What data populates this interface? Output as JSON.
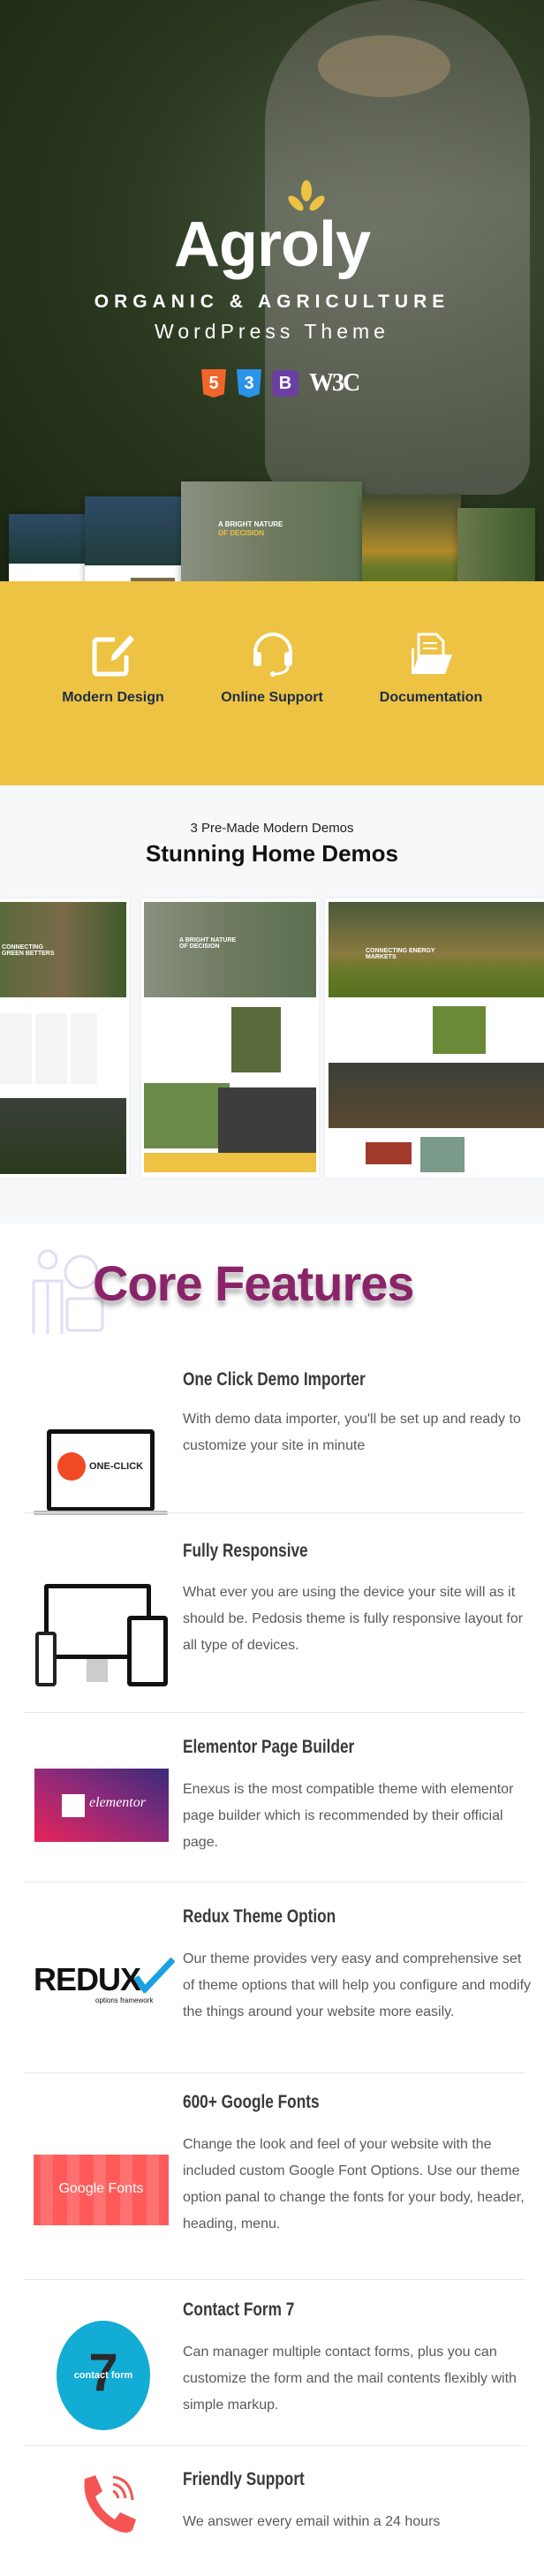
{
  "hero": {
    "logo": "Agroly",
    "tagline": "ORGANIC & AGRICULTURE",
    "subtitle": "WordPress Theme",
    "badges": [
      {
        "icon": "html5-icon",
        "label": "5",
        "color": "#f16529"
      },
      {
        "icon": "css3-icon",
        "label": "3",
        "color": "#2b94e8"
      },
      {
        "icon": "bootstrap-icon",
        "label": "B",
        "color": "#6b3fa0"
      },
      {
        "icon": "w3c-icon",
        "label": "W3C"
      }
    ],
    "mockup_heading": [
      "A BRIGHT NATURE",
      "OF DECISION"
    ]
  },
  "highlights": [
    {
      "icon": "edit-icon",
      "label": "Modern Design"
    },
    {
      "icon": "headset-icon",
      "label": "Online Support"
    },
    {
      "icon": "folder-document-icon",
      "label": "Documentation"
    }
  ],
  "demos": {
    "subtitle": "3 Pre-Made Modern Demos",
    "title": "Stunning Home Demos",
    "cards": [
      {
        "headline": "CONNECTING GREEN BETTERS"
      },
      {
        "headline": "A BRIGHT NATURE OF DECISION"
      },
      {
        "headline": "CONNECTING ENERGY MARKETS"
      }
    ]
  },
  "core": {
    "title": "Core Features",
    "features": [
      {
        "title": "One Click Demo Importer",
        "image": "one-click",
        "image_text": "ONE-CLICK",
        "desc": "With demo data importer, you'll be set up and ready to customize your site in minute"
      },
      {
        "title": "Fully Responsive",
        "image": "devices",
        "desc": "What ever you are using the device your site will as it should be. Pedosis theme is fully responsive layout for all type of devices."
      },
      {
        "title": "Elementor Page Builder",
        "image": "elementor",
        "image_text": "elementor",
        "desc": "Enexus is the most compatible theme with elementor page builder which is recommended by their official page."
      },
      {
        "title": "Redux Theme Option",
        "image": "redux",
        "image_text": "REDUX",
        "image_sub": "options framework",
        "desc": "Our theme provides very easy and comprehensive set of theme options that will help you configure and modify the things around your website more easily."
      },
      {
        "title": "600+ Google Fonts",
        "image": "google-fonts",
        "image_text": "Google Fonts",
        "desc": "Change the look and feel of your website with the included custom Google Font Options. Use our theme option panal to change the fonts for your body, header, heading, menu."
      },
      {
        "title": "Contact Form 7",
        "image": "contact-form-7",
        "image_text": "contact form",
        "desc": "Can manager multiple contact forms, plus you can customize the form and the mail contents flexibly with simple markup."
      },
      {
        "title": "Friendly Support",
        "image": "phone",
        "desc": "We answer every email within a 24 hours"
      }
    ]
  },
  "colors": {
    "accent": "#eec242",
    "navy": "#1c2e4a",
    "purple": "#8a2468"
  }
}
